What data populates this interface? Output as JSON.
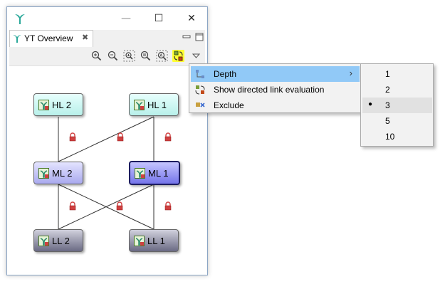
{
  "window": {
    "minimize": "—",
    "maximize": "☐",
    "close": "✕"
  },
  "view": {
    "tab_label": "YT Overview",
    "tab_close": "✖"
  },
  "toolbar": {
    "tools": [
      "zoom-in",
      "zoom-out",
      "zoom-to-fit",
      "zoom-100",
      "zoom-auto",
      "layout-refresh",
      "view-menu"
    ]
  },
  "graph": {
    "nodes": {
      "hl2": "HL 2",
      "hl1": "HL 1",
      "ml2": "ML 2",
      "ml1": "ML 1",
      "ll2": "LL 2",
      "ll1": "LL 1"
    },
    "selected_node": "ML 1"
  },
  "menu": {
    "items": [
      "Depth",
      "Show directed link evaluation",
      "Exclude"
    ],
    "hovered": "Depth"
  },
  "depth_menu": {
    "options": [
      "1",
      "2",
      "3",
      "5",
      "10"
    ],
    "selected": "3"
  },
  "colors": {
    "hl_fill": "#c9f7f2",
    "ml_fill": "#c0c0f5",
    "ml_selected_fill": "#9090f0",
    "ll_fill": "#8a8aa0",
    "menu_hover": "#91c9f7",
    "active_tool": "#ffff33",
    "lock_icon": "#d04040"
  }
}
